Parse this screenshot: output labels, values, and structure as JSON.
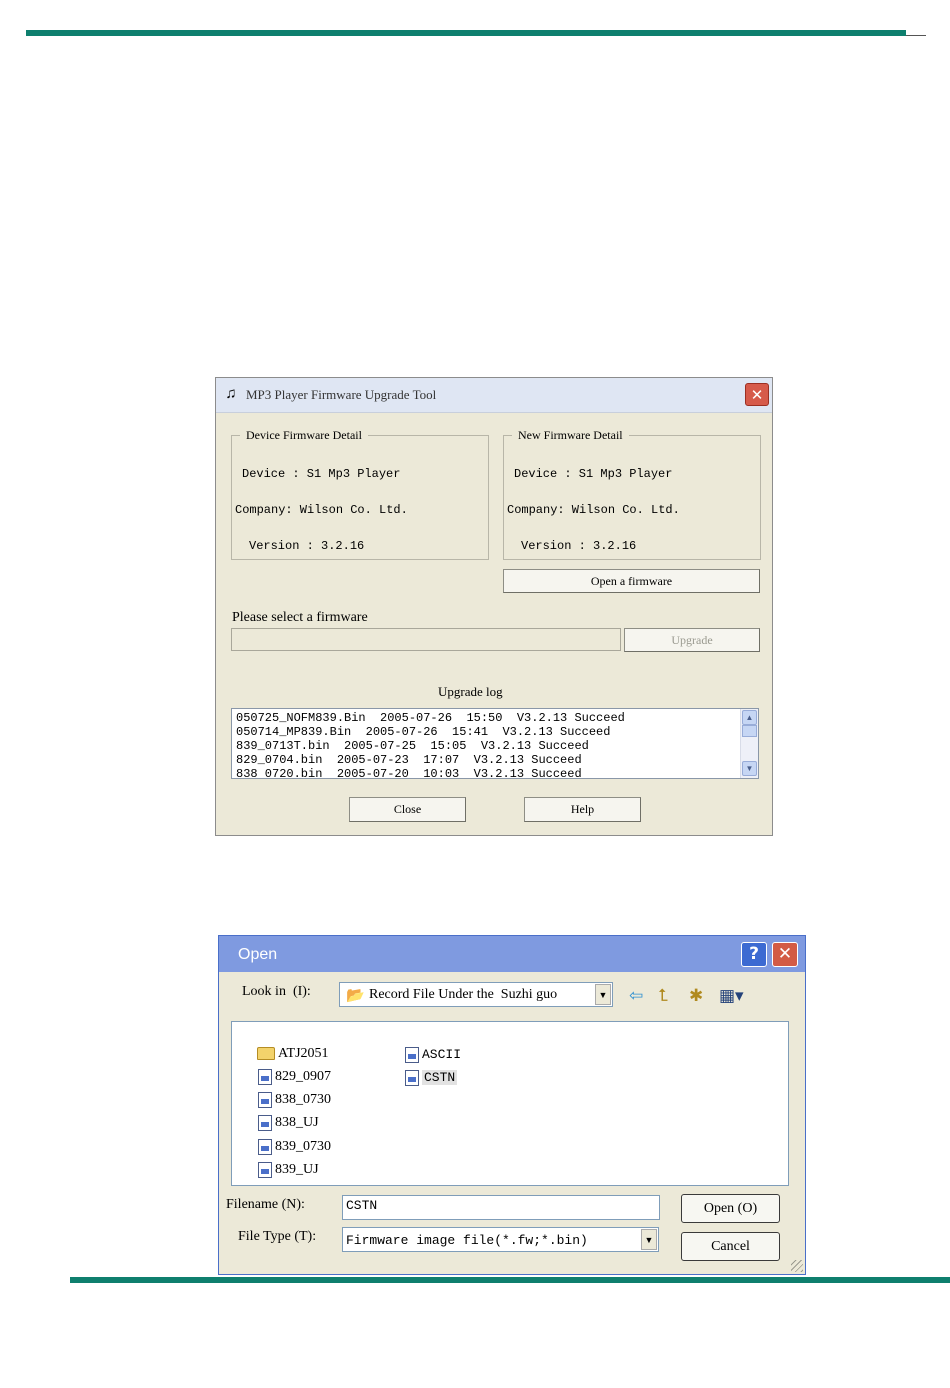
{
  "page": {
    "colors": {
      "rule": "#0e7f6e"
    }
  },
  "upgrade_tool": {
    "title": "MP3 Player Firmware Upgrade Tool",
    "title_icon": "tool-app-icon",
    "device_group": {
      "legend": "Device Firmware Detail",
      "device_row": "Device : S1 Mp3 Player",
      "company_row": "Company: Wilson Co. Ltd.",
      "version_row": "Version : 3.2.16"
    },
    "new_group": {
      "legend": "New Firmware Detail",
      "device_row": "Device : S1 Mp3 Player",
      "company_row": "Company: Wilson Co. Ltd.",
      "version_row": "Version : 3.2.16"
    },
    "open_firmware_button": "Open a firmware",
    "select_label": "Please select a firmware",
    "firmware_path_value": "",
    "upgrade_button": "Upgrade",
    "log_label": "Upgrade log",
    "log_lines": [
      "050725_NOFM839.Bin  2005-07-26  15:50  V3.2.13 Succeed",
      "050714_MP839.Bin  2005-07-26  15:41  V3.2.13 Succeed",
      "839_0713T.bin  2005-07-25  15:05  V3.2.13 Succeed",
      "829_0704.bin  2005-07-23  17:07  V3.2.13 Succeed",
      "838_0720.bin  2005-07-20  10:03  V3.2.13 Succeed"
    ],
    "close_button": "Close",
    "help_button": "Help"
  },
  "open_dialog": {
    "title": "Open",
    "help_glyph": "?",
    "close_glyph": "✕",
    "look_in_label": "Look in  (I):",
    "look_in_value": "Record File Under the  Suzhi guo",
    "files_col1": [
      {
        "name": "ATJ2051",
        "icon": "folder-icon"
      },
      {
        "name": "829_0907",
        "icon": "file-icon"
      },
      {
        "name": "838_0730",
        "icon": "file-icon"
      },
      {
        "name": "838_UJ",
        "icon": "file-icon"
      },
      {
        "name": "839_0730",
        "icon": "file-icon"
      },
      {
        "name": "839_UJ",
        "icon": "file-icon"
      }
    ],
    "files_col2": [
      {
        "name": "ASCII",
        "icon": "file-icon",
        "selected": false
      },
      {
        "name": "CSTN",
        "icon": "file-icon",
        "selected": true
      }
    ],
    "filename_label": "Filename (N):",
    "filename_value": "CSTN",
    "filetype_label": "File Type (T):",
    "filetype_value": "Firmware image file(*.fw;*.bin)",
    "open_button": "Open (O)",
    "cancel_button": "Cancel"
  }
}
